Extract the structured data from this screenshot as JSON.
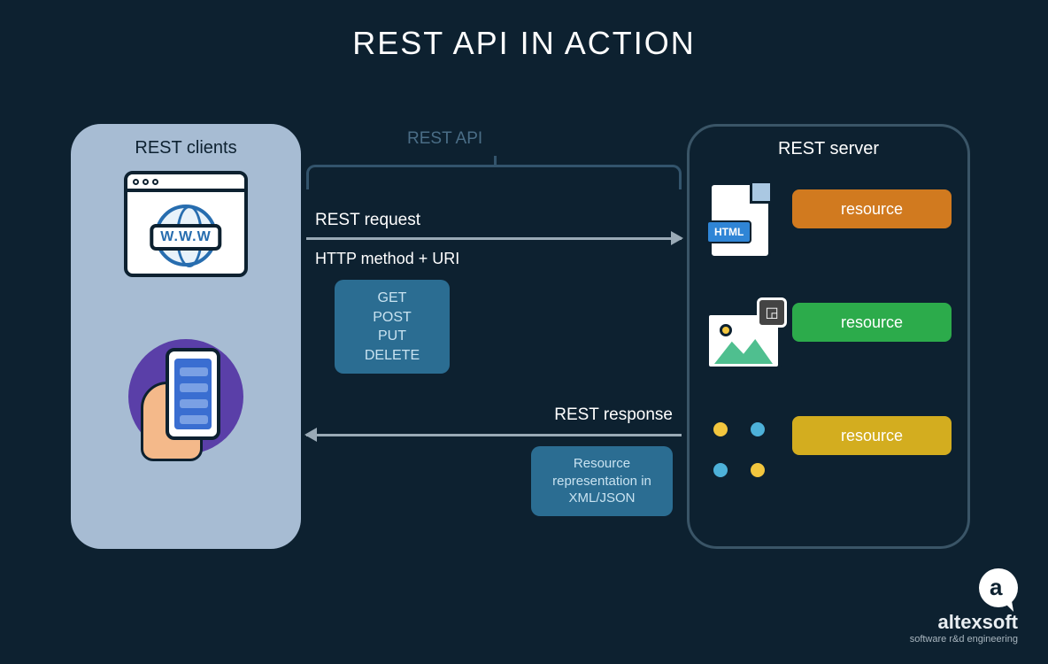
{
  "title": "REST API IN ACTION",
  "clients": {
    "title": "REST clients",
    "www": "W.W.W"
  },
  "middle": {
    "api_label": "REST API",
    "request_label": "REST request",
    "method_label": "HTTP method + URI",
    "methods": [
      "GET",
      "POST",
      "PUT",
      "DELETE"
    ],
    "response_label": "REST response",
    "response_box": "Resource representation in XML/JSON"
  },
  "server": {
    "title": "REST server",
    "resources": [
      {
        "label": "resource",
        "kind": "html",
        "badge": "HTML"
      },
      {
        "label": "resource",
        "kind": "image"
      },
      {
        "label": "resource",
        "kind": "people"
      }
    ]
  },
  "logo": {
    "name": "altexsoft",
    "tag": "software r&d engineering"
  }
}
